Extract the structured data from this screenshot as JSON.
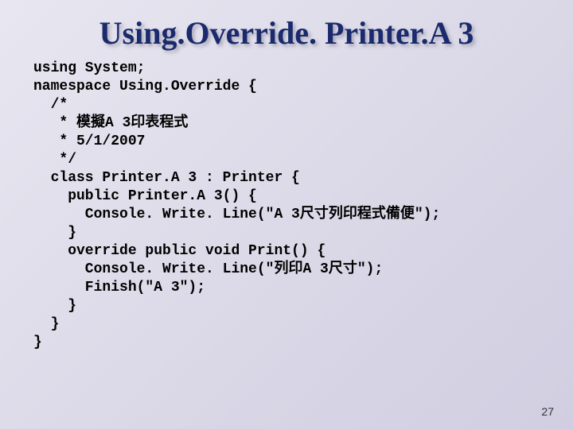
{
  "title": "Using.Override. Printer.A 3",
  "code": "using System;\nnamespace Using.Override {\n  /*\n   * 模擬A 3印表程式\n   * 5/1/2007\n   */\n  class Printer.A 3 : Printer {\n    public Printer.A 3() {\n      Console. Write. Line(\"A 3尺寸列印程式備便\");\n    }\n    override public void Print() {\n      Console. Write. Line(\"列印A 3尺寸\");\n      Finish(\"A 3\");\n    }\n  }\n}",
  "page_number": "27"
}
